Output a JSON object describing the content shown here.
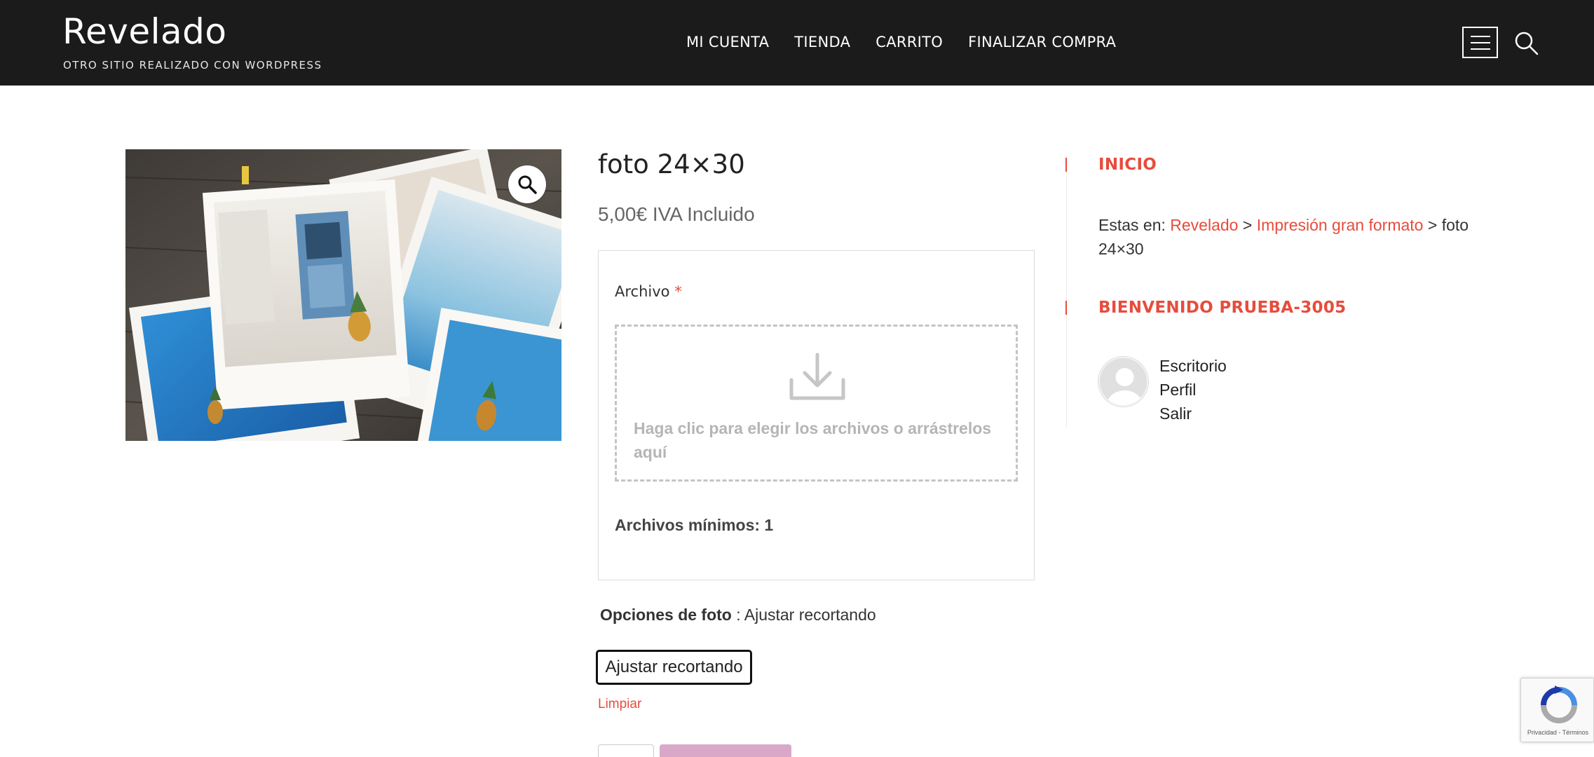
{
  "site": {
    "title": "Revelado",
    "tagline": "OTRO SITIO REALIZADO CON WORDPRESS"
  },
  "nav": {
    "items": [
      "MI CUENTA",
      "TIENDA",
      "CARRITO",
      "FINALIZAR COMPRA"
    ]
  },
  "header_icons": [
    "menu-icon",
    "search-icon"
  ],
  "product": {
    "title": "foto 24×30",
    "price": "5,00€ IVA Incluido",
    "gallery_zoom_icon": "magnifier-icon",
    "upload": {
      "label": "Archivo",
      "required_mark": "*",
      "dropzone_text": "Haga clic para elegir los archivos o arrástrelos aquí",
      "dropzone_icon": "download-icon",
      "min_files": "Archivos mínimos: 1"
    },
    "options": {
      "label": "Opciones de foto",
      "value": ": Ajustar recortando",
      "button": "Ajustar recortando",
      "clear": "Limpiar"
    }
  },
  "sidebar": {
    "widget1": {
      "title": "INICIO",
      "prefix": "Estas en: ",
      "link1": "Revelado",
      "sep1": " > ",
      "link2": "Impresión gran formato",
      "sep2": " > ",
      "current": "foto 24×30"
    },
    "widget2": {
      "title": "BIENVENIDO PRUEBA-3005",
      "links": [
        "Escritorio",
        "Perfil",
        "Salir"
      ]
    }
  },
  "recaptcha": {
    "footer": "Privacidad - Términos"
  },
  "colors": {
    "accent": "#e74c3c",
    "header_bg": "#1b1b1b",
    "add_to_cart_disabled": "#d9a8c9"
  }
}
